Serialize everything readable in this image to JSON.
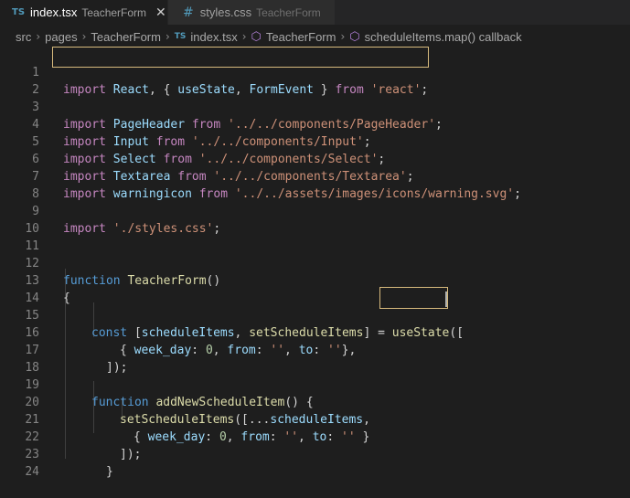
{
  "tabs": [
    {
      "icon": "TS",
      "name": "index.tsx",
      "desc": "TeacherForm",
      "close": "✕"
    },
    {
      "icon": "#",
      "name": "styles.css",
      "desc": "TeacherForm"
    }
  ],
  "breadcrumb": {
    "items": [
      "src",
      "pages",
      "TeacherForm",
      "index.tsx",
      "TeacherForm",
      "scheduleItems.map() callback"
    ],
    "ts_icon": "TS",
    "separator": "›"
  },
  "editor": {
    "line_numbers": [
      "1",
      "2",
      "3",
      "4",
      "5",
      "6",
      "7",
      "8",
      "9",
      "10",
      "11",
      "12",
      "13",
      "14",
      "15",
      "16",
      "17",
      "18",
      "19",
      "20",
      "21",
      "22",
      "23",
      "24"
    ]
  },
  "code": {
    "l1": {
      "import": "import",
      "react": "React",
      "c1": ", { ",
      "useState": "useState",
      "c2": ", ",
      "FormEvent": "FormEvent",
      "c3": " } ",
      "from": "from",
      "sp": " ",
      "mod": "'react'",
      "semi": ";"
    },
    "l3": {
      "import": "import",
      "name": "PageHeader",
      "from": "from",
      "mod": "'../../components/PageHeader'",
      "semi": ";"
    },
    "l4": {
      "import": "import",
      "name": "Input",
      "from": "from",
      "mod": "'../../components/Input'",
      "semi": ";"
    },
    "l5": {
      "import": "import",
      "name": "Select",
      "from": "from",
      "mod": "'../../components/Select'",
      "semi": ";"
    },
    "l6": {
      "import": "import",
      "name": "Textarea",
      "from": "from",
      "mod": "'../../components/Textarea'",
      "semi": ";"
    },
    "l7": {
      "import": "import",
      "name": "warningicon",
      "from": "from",
      "mod": "'../../assets/images/icons/warning.svg'",
      "semi": ";"
    },
    "l9": {
      "import": "import",
      "mod": "'./styles.css'",
      "semi": ";"
    },
    "l12": {
      "function": "function",
      "name": "TeacherForm",
      "paren": "()"
    },
    "l13": {
      "text": "{"
    },
    "l15": {
      "const": "const",
      "open": "[",
      "a": "scheduleItems",
      "comma": ", ",
      "b": "setScheduleItems",
      "close": "] = ",
      "fn": "useState",
      "paren": "(",
      "brk": "["
    },
    "l16": {
      "o": "{ ",
      "k1": "week_day",
      "c1": ": ",
      "v1": "0",
      "c2": ", ",
      "k2": "from",
      "c3": ": ",
      "v2": "''",
      "c4": ", ",
      "k3": "to",
      "c5": ": ",
      "v3": "''",
      "e": "},"
    },
    "l17": {
      "text": "]);"
    },
    "l19": {
      "function": "function",
      "name": "addNewScheduleItem",
      "rest": "() {"
    },
    "l20": {
      "fn": "setScheduleItems",
      "o": "([...",
      "v": "scheduleItems",
      "e": ","
    },
    "l21": {
      "o": "{ ",
      "k1": "week_day",
      "c1": ": ",
      "v1": "0",
      "c2": ", ",
      "k2": "from",
      "c3": ": ",
      "v2": "''",
      "c4": ", ",
      "k3": "to",
      "c5": ": ",
      "v3": "''",
      "e": " }"
    },
    "l22": {
      "text": "]);"
    },
    "l23": {
      "text": "}"
    }
  }
}
